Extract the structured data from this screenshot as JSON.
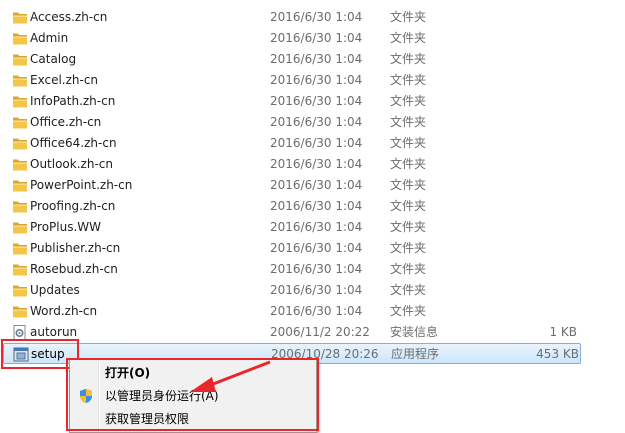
{
  "files": [
    {
      "name": "Access.zh-cn",
      "date": "2016/6/30 1:04",
      "type": "文件夹",
      "size": "",
      "icon": "folder-icon"
    },
    {
      "name": "Admin",
      "date": "2016/6/30 1:04",
      "type": "文件夹",
      "size": "",
      "icon": "folder-icon"
    },
    {
      "name": "Catalog",
      "date": "2016/6/30 1:04",
      "type": "文件夹",
      "size": "",
      "icon": "folder-icon"
    },
    {
      "name": "Excel.zh-cn",
      "date": "2016/6/30 1:04",
      "type": "文件夹",
      "size": "",
      "icon": "folder-icon"
    },
    {
      "name": "InfoPath.zh-cn",
      "date": "2016/6/30 1:04",
      "type": "文件夹",
      "size": "",
      "icon": "folder-icon"
    },
    {
      "name": "Office.zh-cn",
      "date": "2016/6/30 1:04",
      "type": "文件夹",
      "size": "",
      "icon": "folder-icon"
    },
    {
      "name": "Office64.zh-cn",
      "date": "2016/6/30 1:04",
      "type": "文件夹",
      "size": "",
      "icon": "folder-icon"
    },
    {
      "name": "Outlook.zh-cn",
      "date": "2016/6/30 1:04",
      "type": "文件夹",
      "size": "",
      "icon": "folder-icon"
    },
    {
      "name": "PowerPoint.zh-cn",
      "date": "2016/6/30 1:04",
      "type": "文件夹",
      "size": "",
      "icon": "folder-icon"
    },
    {
      "name": "Proofing.zh-cn",
      "date": "2016/6/30 1:04",
      "type": "文件夹",
      "size": "",
      "icon": "folder-icon"
    },
    {
      "name": "ProPlus.WW",
      "date": "2016/6/30 1:04",
      "type": "文件夹",
      "size": "",
      "icon": "folder-icon"
    },
    {
      "name": "Publisher.zh-cn",
      "date": "2016/6/30 1:04",
      "type": "文件夹",
      "size": "",
      "icon": "folder-icon"
    },
    {
      "name": "Rosebud.zh-cn",
      "date": "2016/6/30 1:04",
      "type": "文件夹",
      "size": "",
      "icon": "folder-icon"
    },
    {
      "name": "Updates",
      "date": "2016/6/30 1:04",
      "type": "文件夹",
      "size": "",
      "icon": "folder-icon"
    },
    {
      "name": "Word.zh-cn",
      "date": "2016/6/30 1:04",
      "type": "文件夹",
      "size": "",
      "icon": "folder-icon"
    },
    {
      "name": "autorun",
      "date": "2006/11/2 20:22",
      "type": "安装信息",
      "size": "1 KB",
      "icon": "settings-file-icon"
    },
    {
      "name": "setup",
      "date": "2006/10/28 20:26",
      "type": "应用程序",
      "size": "453 KB",
      "icon": "setup-exe-icon",
      "selected": true
    }
  ],
  "context_menu": {
    "items": [
      {
        "label": "打开(O)",
        "bold": true,
        "icon": ""
      },
      {
        "label": "以管理员身份运行(A)",
        "bold": false,
        "icon": "uac-shield-icon"
      },
      {
        "label": "获取管理员权限",
        "bold": false,
        "icon": ""
      }
    ]
  },
  "colors": {
    "selection_fill": "#cde6fb",
    "selection_border": "#84acdd",
    "annotation_red": "#e8262b",
    "folder_yellow": "#f3c64a"
  }
}
